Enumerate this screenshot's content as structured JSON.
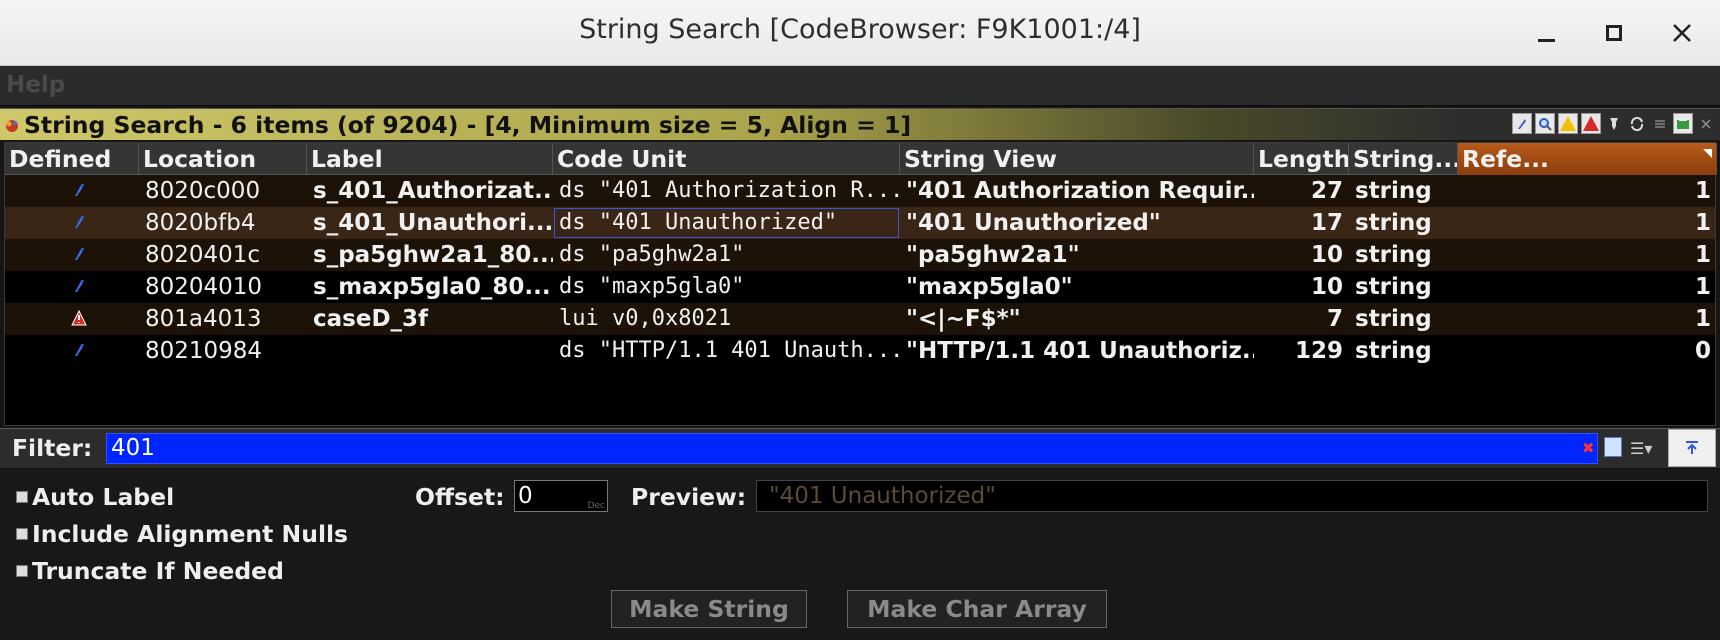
{
  "window": {
    "title": "String Search [CodeBrowser: F9K1001:/4]"
  },
  "menu": {
    "help": "Help"
  },
  "panel": {
    "title": "String Search - 6 items (of 9204) - [4, Minimum size = 5, Align = 1]"
  },
  "table": {
    "columns": [
      "Defined",
      "Location",
      "Label",
      "Code Unit",
      "String View",
      "Length",
      "String...",
      "Refe..."
    ],
    "sorted_column": "Refe...",
    "rows": [
      {
        "defined_icon": "defined-string-icon",
        "location": "8020c000",
        "label": "s_401_Authorizat...",
        "code_unit": "ds \"401 Authorization R...",
        "string_view": "\"401 Authorization Requir...",
        "length": "27",
        "string_type": "string",
        "refs": "1"
      },
      {
        "defined_icon": "defined-string-icon",
        "location": "8020bfb4",
        "label": "s_401_Unauthori...",
        "code_unit": "ds \"401 Unauthorized\"",
        "string_view": "\"401 Unauthorized\"",
        "length": "17",
        "string_type": "string",
        "refs": "1"
      },
      {
        "defined_icon": "defined-string-icon",
        "location": "8020401c",
        "label": "s_pa5ghw2a1_80...",
        "code_unit": "ds \"pa5ghw2a1\"",
        "string_view": "\"pa5ghw2a1\"",
        "length": "10",
        "string_type": "string",
        "refs": "1"
      },
      {
        "defined_icon": "defined-string-icon",
        "location": "80204010",
        "label": "s_maxp5gla0_80...",
        "code_unit": "ds \"maxp5gla0\"",
        "string_view": "\"maxp5gla0\"",
        "length": "10",
        "string_type": "string",
        "refs": "1"
      },
      {
        "defined_icon": "conflict-warning-icon",
        "location": "801a4013",
        "label": "caseD_3f",
        "code_unit": "lui v0,0x8021",
        "string_view": "\"<|~F$*\"",
        "length": "7",
        "string_type": "string",
        "refs": "1"
      },
      {
        "defined_icon": "defined-string-icon",
        "location": "80210984",
        "label": "",
        "code_unit": "ds \"HTTP/1.1 401 Unauth...",
        "string_view": "\"HTTP/1.1 401 Unauthoriz...",
        "length": "129",
        "string_type": "string",
        "refs": "0"
      }
    ]
  },
  "filter": {
    "label": "Filter:",
    "value": "401"
  },
  "options": {
    "auto_label": "Auto Label",
    "include_alignment_nulls": "Include Alignment Nulls",
    "truncate_if_needed": "Truncate If Needed",
    "offset_label": "Offset:",
    "offset_value": "0",
    "offset_unit": "Dec",
    "preview_label": "Preview:",
    "preview_value": "\"401 Unauthorized\"",
    "make_string": "Make String",
    "make_char_array": "Make Char Array"
  },
  "colors": {
    "selected_row": "#3a2616",
    "filter_bg": "#0026ff",
    "sorted_header": "#b85a1a",
    "panel_header": "#cfc86a"
  }
}
